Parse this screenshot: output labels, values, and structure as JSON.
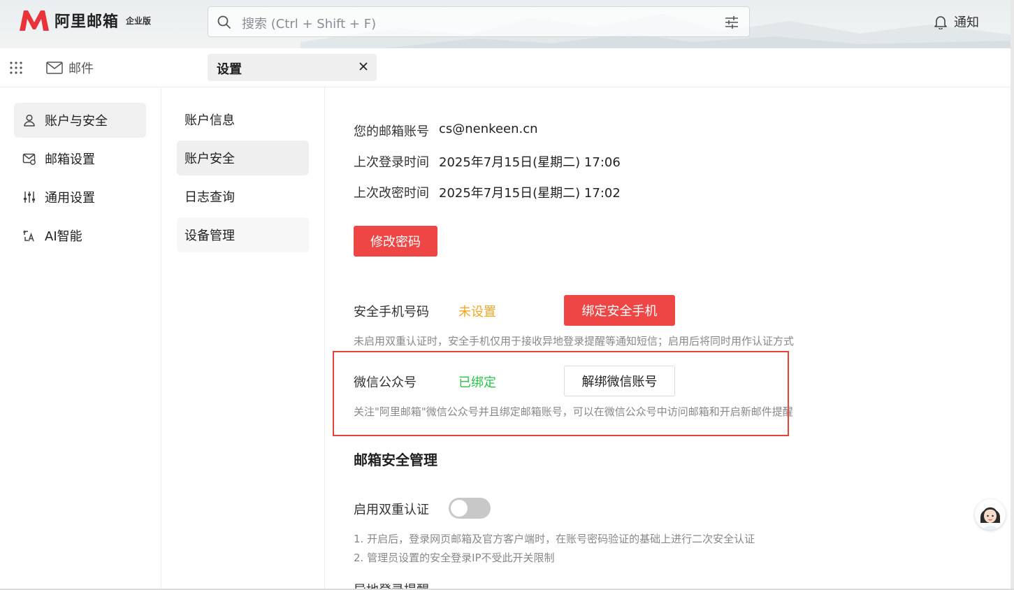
{
  "header": {
    "logo_text": "阿里邮箱",
    "logo_badge": "企业版",
    "search_placeholder": "搜索 (Ctrl + Shift + F)",
    "notify_label": "通知"
  },
  "tabs": {
    "mail_label": "邮件",
    "settings_label": "设置"
  },
  "sidebar": {
    "items": [
      {
        "label": "账户与安全",
        "icon": "user-icon"
      },
      {
        "label": "邮箱设置",
        "icon": "mailbox-settings-icon"
      },
      {
        "label": "通用设置",
        "icon": "sliders-icon"
      },
      {
        "label": "AI智能",
        "icon": "ai-translate-icon"
      }
    ]
  },
  "submenu": {
    "items": [
      "账户信息",
      "账户安全",
      "日志查询",
      "设备管理"
    ]
  },
  "account": {
    "email_key": "您的邮箱账号",
    "email_value": "cs@nenkeen.cn",
    "last_login_key": "上次登录时间",
    "last_login_value": "2025年7月15日(星期二) 17:06",
    "last_pwd_key": "上次改密时间",
    "last_pwd_value": "2025年7月15日(星期二) 17:02",
    "change_pwd_btn": "修改密码"
  },
  "phone": {
    "label": "安全手机号码",
    "status": "未设置",
    "bind_btn": "绑定安全手机",
    "hint": "未启用双重认证时，安全手机仅用于接收异地登录提醒等通知短信；启用后将同时用作认证方式"
  },
  "wechat": {
    "label": "微信公众号",
    "status": "已绑定",
    "unbind_btn": "解绑微信账号",
    "hint": "关注\"阿里邮箱\"微信公众号并且绑定邮箱账号，可以在微信公众号中访问邮箱和开启新邮件提醒"
  },
  "security": {
    "title": "邮箱安全管理",
    "two_factor_label": "启用双重认证",
    "two_factor_enabled": false,
    "note1": "1. 开启后，登录网页邮箱及官方客户端时，在账号密码验证的基础上进行二次安全认证",
    "note2": "2. 管理员设置的安全登录IP不受此开关限制",
    "next_label": "异地登录提醒"
  },
  "colors": {
    "brand_red": "#ee4545",
    "status_orange": "#f5a623",
    "status_green": "#2bc24a",
    "highlight_box": "#e8423c"
  }
}
